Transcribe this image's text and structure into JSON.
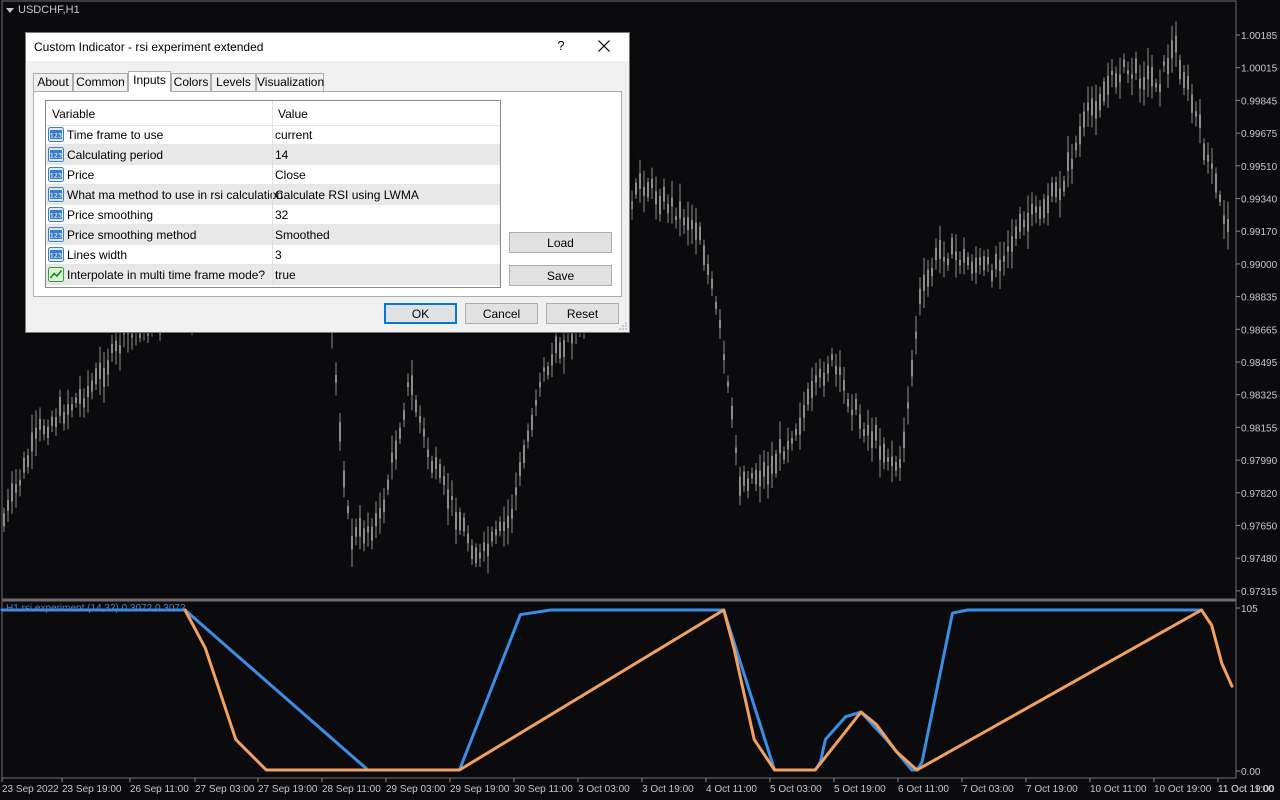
{
  "chart": {
    "symbol": "USDCHF,H1",
    "indicator_label": "H1 rsi experiment (14,32) 0.3072 0.3072",
    "price_ticks": [
      "1.00185",
      "1.00015",
      "0.99845",
      "0.99675",
      "0.99510",
      "0.99340",
      "0.99170",
      "0.99000",
      "0.98835",
      "0.98665",
      "0.98495",
      "0.98325",
      "0.98155",
      "0.97990",
      "0.97820",
      "0.97650",
      "0.97480",
      "0.97315"
    ],
    "indicator_ticks": [
      "105",
      "0.00"
    ],
    "time_ticks": [
      "23 Sep 2022",
      "23 Sep 19:00",
      "26 Sep 11:00",
      "27 Sep 03:00",
      "27 Sep 19:00",
      "28 Sep 11:00",
      "29 Sep 03:00",
      "29 Sep 19:00",
      "30 Sep 11:00",
      "3 Oct 03:00",
      "3 Oct 19:00",
      "4 Oct 11:00",
      "5 Oct 03:00",
      "5 Oct 19:00",
      "6 Oct 11:00",
      "7 Oct 03:00",
      "7 Oct 19:00",
      "10 Oct 11:00",
      "10 Oct 19:00",
      "11 Oct 11:00",
      "11 Oct 19:00"
    ],
    "colors": {
      "background": "#0b0b0e",
      "candles": "#8c8c8c",
      "rsi_up": "#3a8ee6",
      "rsi_down": "#f2a060",
      "text": "#c8c8c8"
    }
  },
  "chart_data": {
    "type": "line",
    "y_range": [
      0,
      105
    ],
    "series": [
      {
        "color": "#3a8ee6",
        "points": [
          [
            0,
            105
          ],
          [
            18,
            105
          ],
          [
            36,
            0
          ],
          [
            45,
            0
          ],
          [
            51,
            102
          ],
          [
            54,
            105
          ],
          [
            71,
            105
          ],
          [
            76,
            0
          ],
          [
            80,
            0
          ],
          [
            80.5,
            5
          ],
          [
            81,
            20
          ],
          [
            83,
            35
          ],
          [
            84.5,
            38
          ],
          [
            87,
            20
          ],
          [
            89.5,
            0
          ],
          [
            90,
            0
          ],
          [
            90.5,
            5
          ],
          [
            93.5,
            103
          ],
          [
            95,
            105
          ],
          [
            118,
            105
          ]
        ]
      },
      {
        "color": "#f2a060",
        "points": [
          [
            18,
            105
          ],
          [
            20,
            80
          ],
          [
            23,
            20
          ],
          [
            26,
            0
          ],
          [
            31,
            0
          ],
          [
            35,
            0
          ],
          [
            36,
            0
          ],
          [
            45,
            0
          ],
          [
            45,
            0
          ],
          [
            71,
            105
          ],
          [
            72,
            80
          ],
          [
            74,
            20
          ],
          [
            76,
            0
          ],
          [
            80,
            0
          ],
          [
            84.5,
            38
          ],
          [
            86,
            30
          ],
          [
            88,
            12
          ],
          [
            90,
            0
          ],
          [
            118,
            105
          ],
          [
            119,
            95
          ],
          [
            120,
            70
          ],
          [
            121,
            55
          ]
        ]
      }
    ]
  },
  "dialog": {
    "title": "Custom Indicator - rsi experiment extended",
    "help": "?",
    "tabs": [
      "About",
      "Common",
      "Inputs",
      "Colors",
      "Levels",
      "Visualization"
    ],
    "active_tab": "Inputs",
    "columns": {
      "variable": "Variable",
      "value": "Value"
    },
    "params": [
      {
        "icon": "123",
        "name": "Time frame to use",
        "value": "current"
      },
      {
        "icon": "123",
        "name": "Calculating period",
        "value": "14"
      },
      {
        "icon": "123",
        "name": "Price",
        "value": "Close"
      },
      {
        "icon": "123",
        "name": "What ma method to use in rsi calculation",
        "value": "Calculate RSI using LWMA"
      },
      {
        "icon": "123",
        "name": "Price smoothing",
        "value": "32"
      },
      {
        "icon": "123",
        "name": "Price smoothing method",
        "value": "Smoothed"
      },
      {
        "icon": "123",
        "name": "Lines width",
        "value": "3"
      },
      {
        "icon": "bool",
        "name": "Interpolate in multi time frame mode?",
        "value": "true"
      }
    ],
    "buttons": {
      "load": "Load",
      "save": "Save",
      "ok": "OK",
      "cancel": "Cancel",
      "reset": "Reset"
    }
  }
}
